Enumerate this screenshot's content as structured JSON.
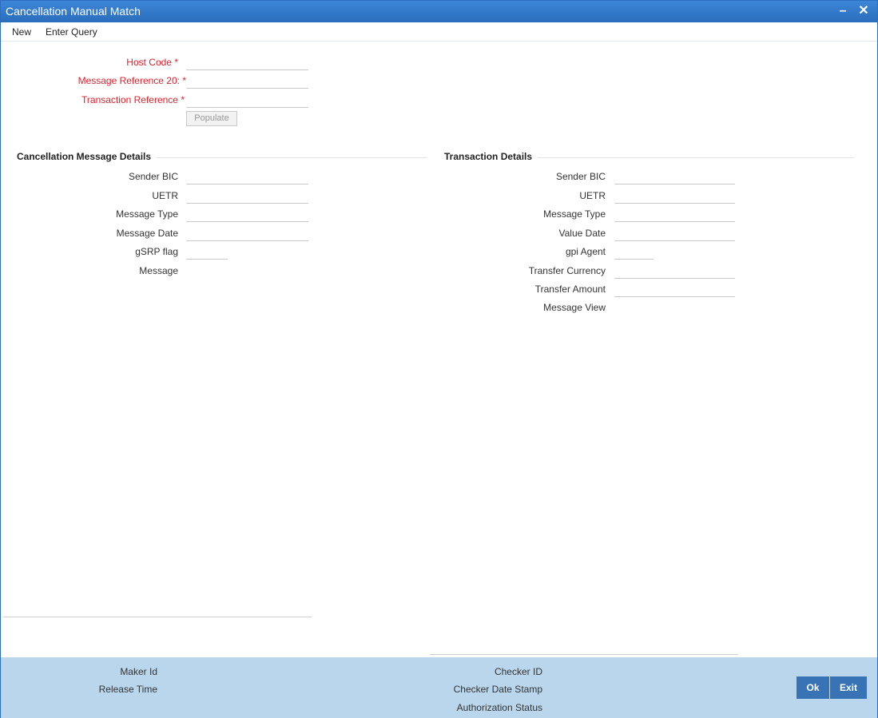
{
  "window": {
    "title": "Cancellation Manual Match"
  },
  "titlebar": {
    "minimize_icon": "minimize-icon",
    "close_icon": "close-icon",
    "minimize_glyph": "–",
    "close_glyph": "✕"
  },
  "menu": {
    "new": "New",
    "enter_query": "Enter Query"
  },
  "header_form": {
    "host_code_label": "Host Code",
    "message_reference_label": "Message Reference 20:",
    "transaction_reference_label": "Transaction Reference",
    "required_marker": "*",
    "populate_button": "Populate"
  },
  "cancellation_details": {
    "title": "Cancellation Message Details",
    "sender_bic": "Sender BIC",
    "uetr": "UETR",
    "message_type": "Message Type",
    "message_date": "Message Date",
    "gsrp_flag": "gSRP flag",
    "message": "Message"
  },
  "transaction_details": {
    "title": "Transaction Details",
    "sender_bic": "Sender BIC",
    "uetr": "UETR",
    "message_type": "Message Type",
    "value_date": "Value Date",
    "gpi_agent": "gpi Agent",
    "transfer_currency": "Transfer Currency",
    "transfer_amount": "Transfer Amount",
    "message_view": "Message View"
  },
  "footer": {
    "maker_id": "Maker Id",
    "release_time": "Release Time",
    "checker_id": "Checker ID",
    "checker_date_stamp": "Checker Date Stamp",
    "authorization_status": "Authorization Status",
    "ok_button": "Ok",
    "exit_button": "Exit"
  },
  "colors": {
    "titlebar": "#2a6ebd",
    "required_label": "#e0202c",
    "footer_bg": "#bad6ec",
    "button_bg": "#3773b5"
  }
}
